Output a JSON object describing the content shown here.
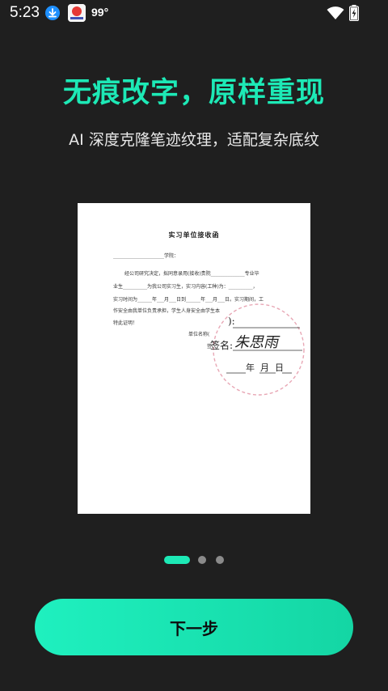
{
  "status_bar": {
    "time": "5:23",
    "temperature": "99°",
    "icons": [
      "download-icon",
      "app-badge-icon",
      "wifi-icon",
      "battery-charging-icon"
    ]
  },
  "headline": "无痕改字，原样重现",
  "subline": "AI 深度克隆笔迹纹理，适配复杂底纹",
  "document": {
    "title": "实习单位接收函",
    "lines": [
      "_____________________学院：",
      "经公司研究决定，拟同意录用(接收)贵院______________专业毕",
      "业生__________为我公司实习生，实习内容(工种)为：__________，",
      "实习时间为______年___月___日到______年___月___日。实习期间，工",
      "作安全由我单位负责承担，学生人身安全由学生本",
      "特此证明！",
      "单位名称(",
      "签"
    ],
    "stamp_field_1": "):",
    "stamp_field_2": "签名:",
    "stamp_name": "朱思雨",
    "stamp_date": "年  月  日"
  },
  "pager": {
    "count": 3,
    "active_index": 0
  },
  "next_button_label": "下一步",
  "colors": {
    "accent": "#1de9b6",
    "background": "#1f1f1f",
    "stamp": "#e8a7b5"
  }
}
